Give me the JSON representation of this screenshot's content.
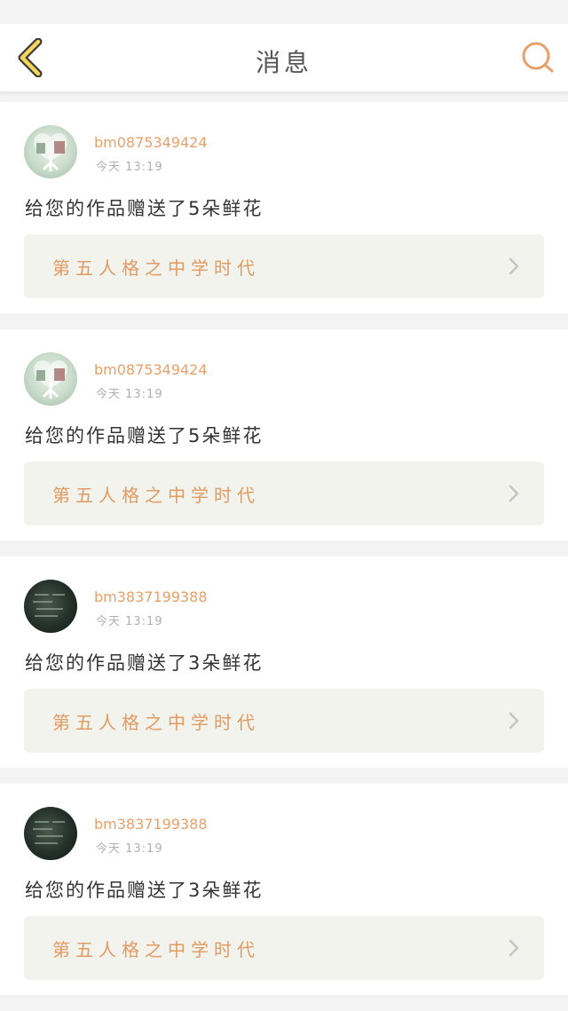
{
  "header": {
    "title": "消息",
    "back_icon": "chevron-left-icon",
    "search_icon": "search-icon",
    "accent_color": "#e8a06a"
  },
  "messages": [
    {
      "username": "bm0875349424",
      "time": "今天 13:19",
      "text": "给您的作品赠送了5朵鲜花",
      "work_title": "第五人格之中学时代"
    },
    {
      "username": "bm0875349424",
      "time": "今天 13:19",
      "text": "给您的作品赠送了5朵鲜花",
      "work_title": "第五人格之中学时代"
    },
    {
      "username": "bm3837199388",
      "time": "今天 13:19",
      "text": "给您的作品赠送了3朵鲜花",
      "work_title": "第五人格之中学时代"
    },
    {
      "username": "bm3837199388",
      "time": "今天 13:19",
      "text": "给您的作品赠送了3朵鲜花",
      "work_title": "第五人格之中学时代"
    }
  ]
}
